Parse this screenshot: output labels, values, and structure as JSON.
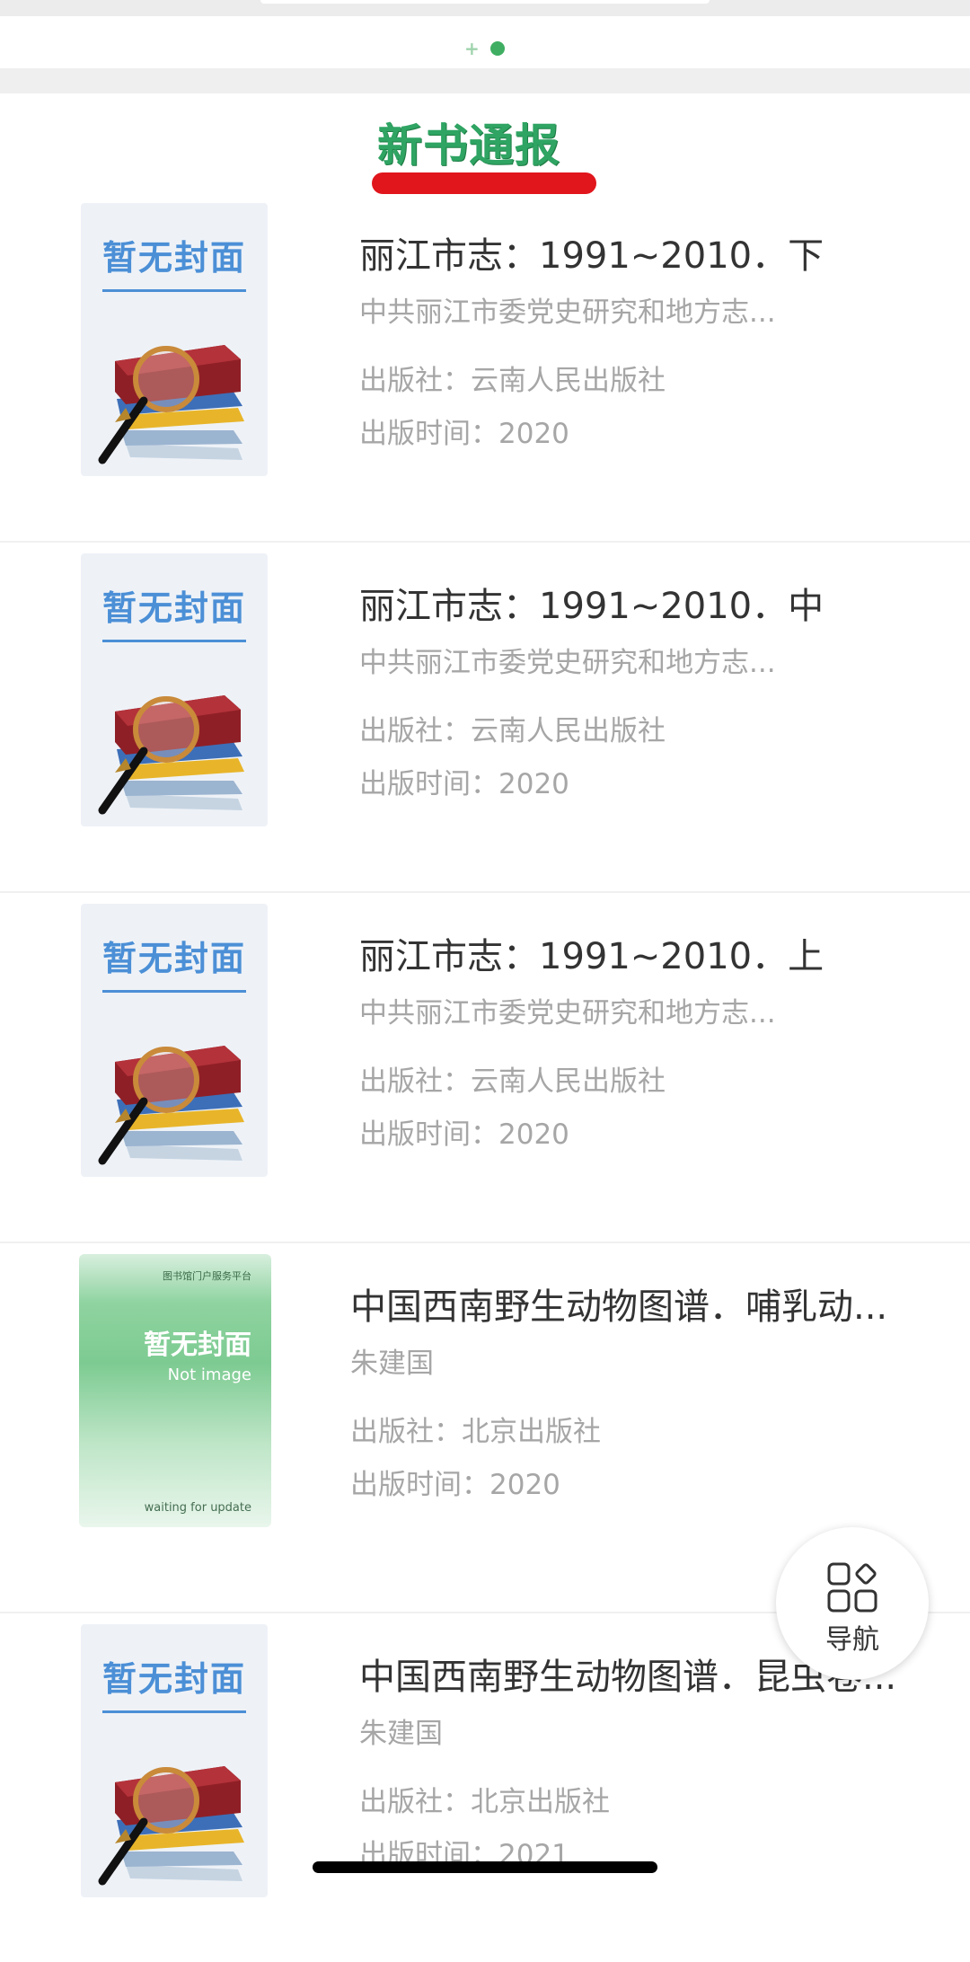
{
  "section": {
    "title": "新书通报"
  },
  "placeholder_cover": {
    "title": "暂无封面"
  },
  "green_cover": {
    "platform": "图书馆门户服务平台",
    "cn": "暂无封面",
    "en": "Not image",
    "waiting": "waiting for update"
  },
  "books": [
    {
      "title": "丽江市志：1991~2010．下",
      "author": "中共丽江市委党史研究和地方志...",
      "publisher": "出版社：云南人民出版社",
      "date": "出版时间：2020",
      "cover": "placeholder"
    },
    {
      "title": "丽江市志：1991~2010．中",
      "author": "中共丽江市委党史研究和地方志...",
      "publisher": "出版社：云南人民出版社",
      "date": "出版时间：2020",
      "cover": "placeholder"
    },
    {
      "title": "丽江市志：1991~2010．上",
      "author": "中共丽江市委党史研究和地方志...",
      "publisher": "出版社：云南人民出版社",
      "date": "出版时间：2020",
      "cover": "placeholder"
    },
    {
      "title": "中国西南野生动物图谱．哺乳动...",
      "author": "朱建国",
      "publisher": "出版社：北京出版社",
      "date": "出版时间：2020",
      "cover": "green"
    },
    {
      "title": "中国西南野生动物图谱．昆虫卷...",
      "author": "朱建国",
      "publisher": "出版社：北京出版社",
      "date": "出版时间：2021",
      "cover": "placeholder"
    }
  ],
  "nav": {
    "label": "导航",
    "icon": "grid-icon"
  },
  "colors": {
    "accent": "#3fae62",
    "underline": "#e0161c",
    "cover_blue": "#4b8fd6"
  }
}
